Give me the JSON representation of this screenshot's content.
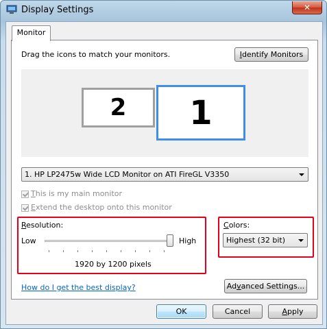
{
  "window": {
    "title": "Display Settings",
    "close_label": "✕"
  },
  "tabs": [
    {
      "label": "Monitor"
    }
  ],
  "monitor_tab": {
    "instruction": "Drag the icons to match your monitors.",
    "identify_button": {
      "pre": "",
      "key": "I",
      "post": "dentify Monitors"
    },
    "monitors": [
      {
        "number": "2",
        "selected": false
      },
      {
        "number": "1",
        "selected": true
      }
    ],
    "monitor_select": {
      "value": "1. HP LP2475w Wide LCD Monitor on ATI FireGL V3350"
    },
    "main_monitor_checkbox": {
      "key": "T",
      "rest": "his is my main monitor",
      "checked": true,
      "enabled": false
    },
    "extend_checkbox": {
      "key": "E",
      "rest": "xtend the desktop onto this monitor",
      "checked": true,
      "enabled": false
    },
    "resolution": {
      "label_key": "R",
      "label_rest": "esolution:",
      "low_label": "Low",
      "high_label": "High",
      "value_text": "1920 by 1200 pixels",
      "slider_level": 1.0
    },
    "colors": {
      "label_key": "C",
      "label_rest": "olors:",
      "value": "Highest (32 bit)"
    },
    "help_link": "How do I get the best display?",
    "advanced_button": {
      "pre": "Ad",
      "key": "v",
      "post": "anced Settings..."
    }
  },
  "footer": {
    "ok_label": "OK",
    "cancel_label": "Cancel",
    "apply_label": {
      "key": "A",
      "rest": "pply"
    }
  },
  "colors": {
    "highlight_box": "#e4001b",
    "selected_monitor_border": "#3c8ee8",
    "unselected_monitor_border": "#a0a0a0",
    "link": "#0066cc"
  }
}
